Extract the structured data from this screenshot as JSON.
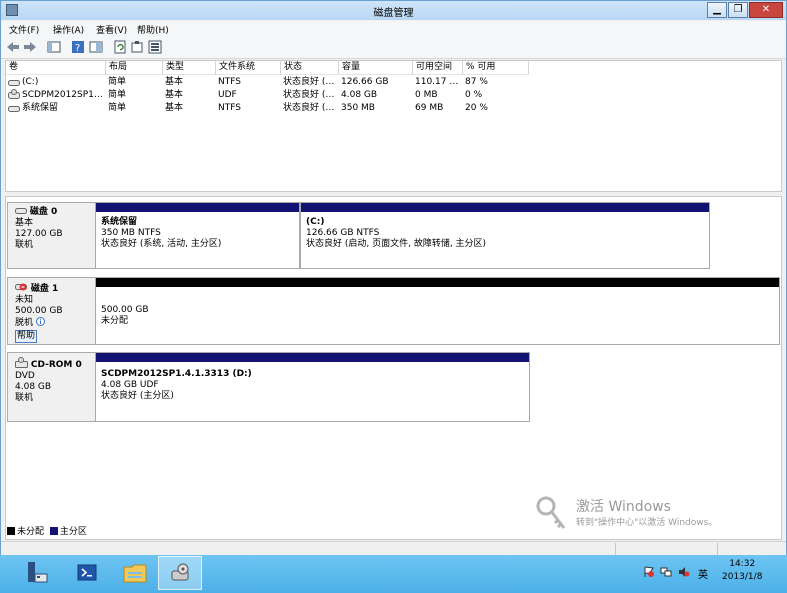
{
  "window": {
    "title": "磁盘管理"
  },
  "menu": [
    "文件(F)",
    "操作(A)",
    "查看(V)",
    "帮助(H)"
  ],
  "volumes": {
    "columns": [
      "卷",
      "布局",
      "类型",
      "文件系统",
      "状态",
      "容量",
      "可用空间",
      "% 可用"
    ],
    "rows": [
      [
        "(C:)",
        "简单",
        "基本",
        "NTFS",
        "状态良好 (…",
        "126.66 GB",
        "110.17 …",
        "87 %"
      ],
      [
        "SCDPM2012SP1…",
        "简单",
        "基本",
        "UDF",
        "状态良好 (…",
        "4.08 GB",
        "0 MB",
        "0 %"
      ],
      [
        "系统保留",
        "简单",
        "基本",
        "NTFS",
        "状态良好 (…",
        "350 MB",
        "69 MB",
        "20 %"
      ]
    ]
  },
  "disks": [
    {
      "name": "磁盘 0",
      "type": "基本",
      "size": "127.00 GB",
      "status": "联机",
      "partitions": [
        {
          "name": "系统保留",
          "size": "350 MB NTFS",
          "status": "状态良好 (系统, 活动, 主分区)"
        },
        {
          "name": "(C:)",
          "size": "126.66 GB NTFS",
          "status": "状态良好 (启动, 页面文件, 故障转储, 主分区)"
        }
      ]
    },
    {
      "name": "磁盘 1",
      "type": "未知",
      "size": "500.00 GB",
      "status": "脱机",
      "help": "帮助",
      "partitions": [
        {
          "size": "500.00 GB",
          "status": "未分配"
        }
      ]
    },
    {
      "name": "CD-ROM 0",
      "type": "DVD",
      "size": "4.08 GB",
      "status": "联机",
      "partitions": [
        {
          "name": "SCDPM2012SP1.4.1.3313  (D:)",
          "size": "4.08 GB UDF",
          "status": "状态良好 (主分区)"
        }
      ]
    }
  ],
  "legend": [
    {
      "label": "未分配",
      "color": "#000000"
    },
    {
      "label": "主分区",
      "color": "#131374"
    }
  ],
  "watermark": {
    "line1": "激活 Windows",
    "line2": "转到\"操作中心\"以激活 Windows。"
  },
  "taskbar": {
    "time": "14:32",
    "date": "2013/1/8",
    "ime": "英"
  }
}
